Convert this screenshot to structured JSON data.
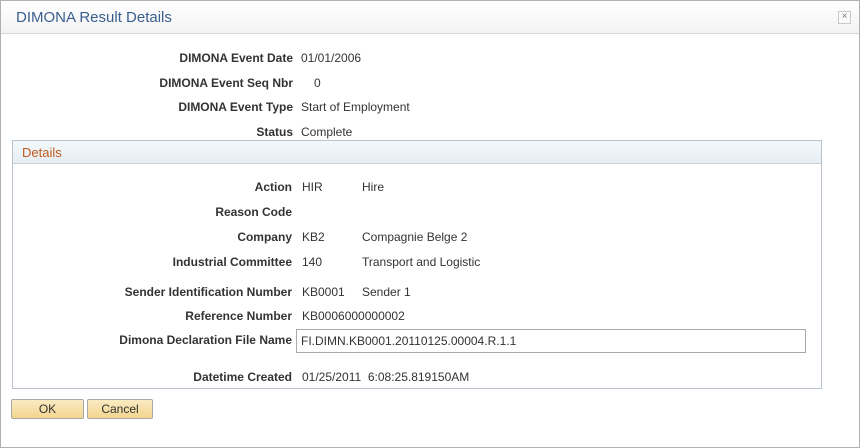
{
  "dialog": {
    "title": "DIMONA Result Details",
    "close_icon": "close-icon"
  },
  "fields": {
    "event_date": {
      "label": "DIMONA Event Date",
      "value": "01/01/2006"
    },
    "event_seq": {
      "label": "DIMONA Event Seq Nbr",
      "value": "0"
    },
    "event_type": {
      "label": "DIMONA Event Type",
      "value": "Start of Employment"
    },
    "status": {
      "label": "Status",
      "value": "Complete"
    }
  },
  "details": {
    "title": "Details",
    "action": {
      "label": "Action",
      "code": "HIR",
      "desc": "Hire"
    },
    "reason": {
      "label": "Reason Code"
    },
    "company": {
      "label": "Company",
      "code": "KB2",
      "desc": "Compagnie Belge 2"
    },
    "committee": {
      "label": "Industrial Committee",
      "code": "140",
      "desc": "Transport and Logistic"
    },
    "sender": {
      "label": "Sender Identification Number",
      "code": "KB0001",
      "desc": "Sender 1"
    },
    "reference": {
      "label": "Reference Number",
      "value": "KB0006000000002"
    },
    "file_name": {
      "label": "Dimona Declaration File Name",
      "value": "FI.DIMN.KB0001.20110125.00004.R.1.1"
    },
    "datetime": {
      "label": "Datetime Created",
      "value": "01/25/2011  6:08:25.819150AM"
    }
  },
  "buttons": {
    "ok": "OK",
    "cancel": "Cancel"
  }
}
